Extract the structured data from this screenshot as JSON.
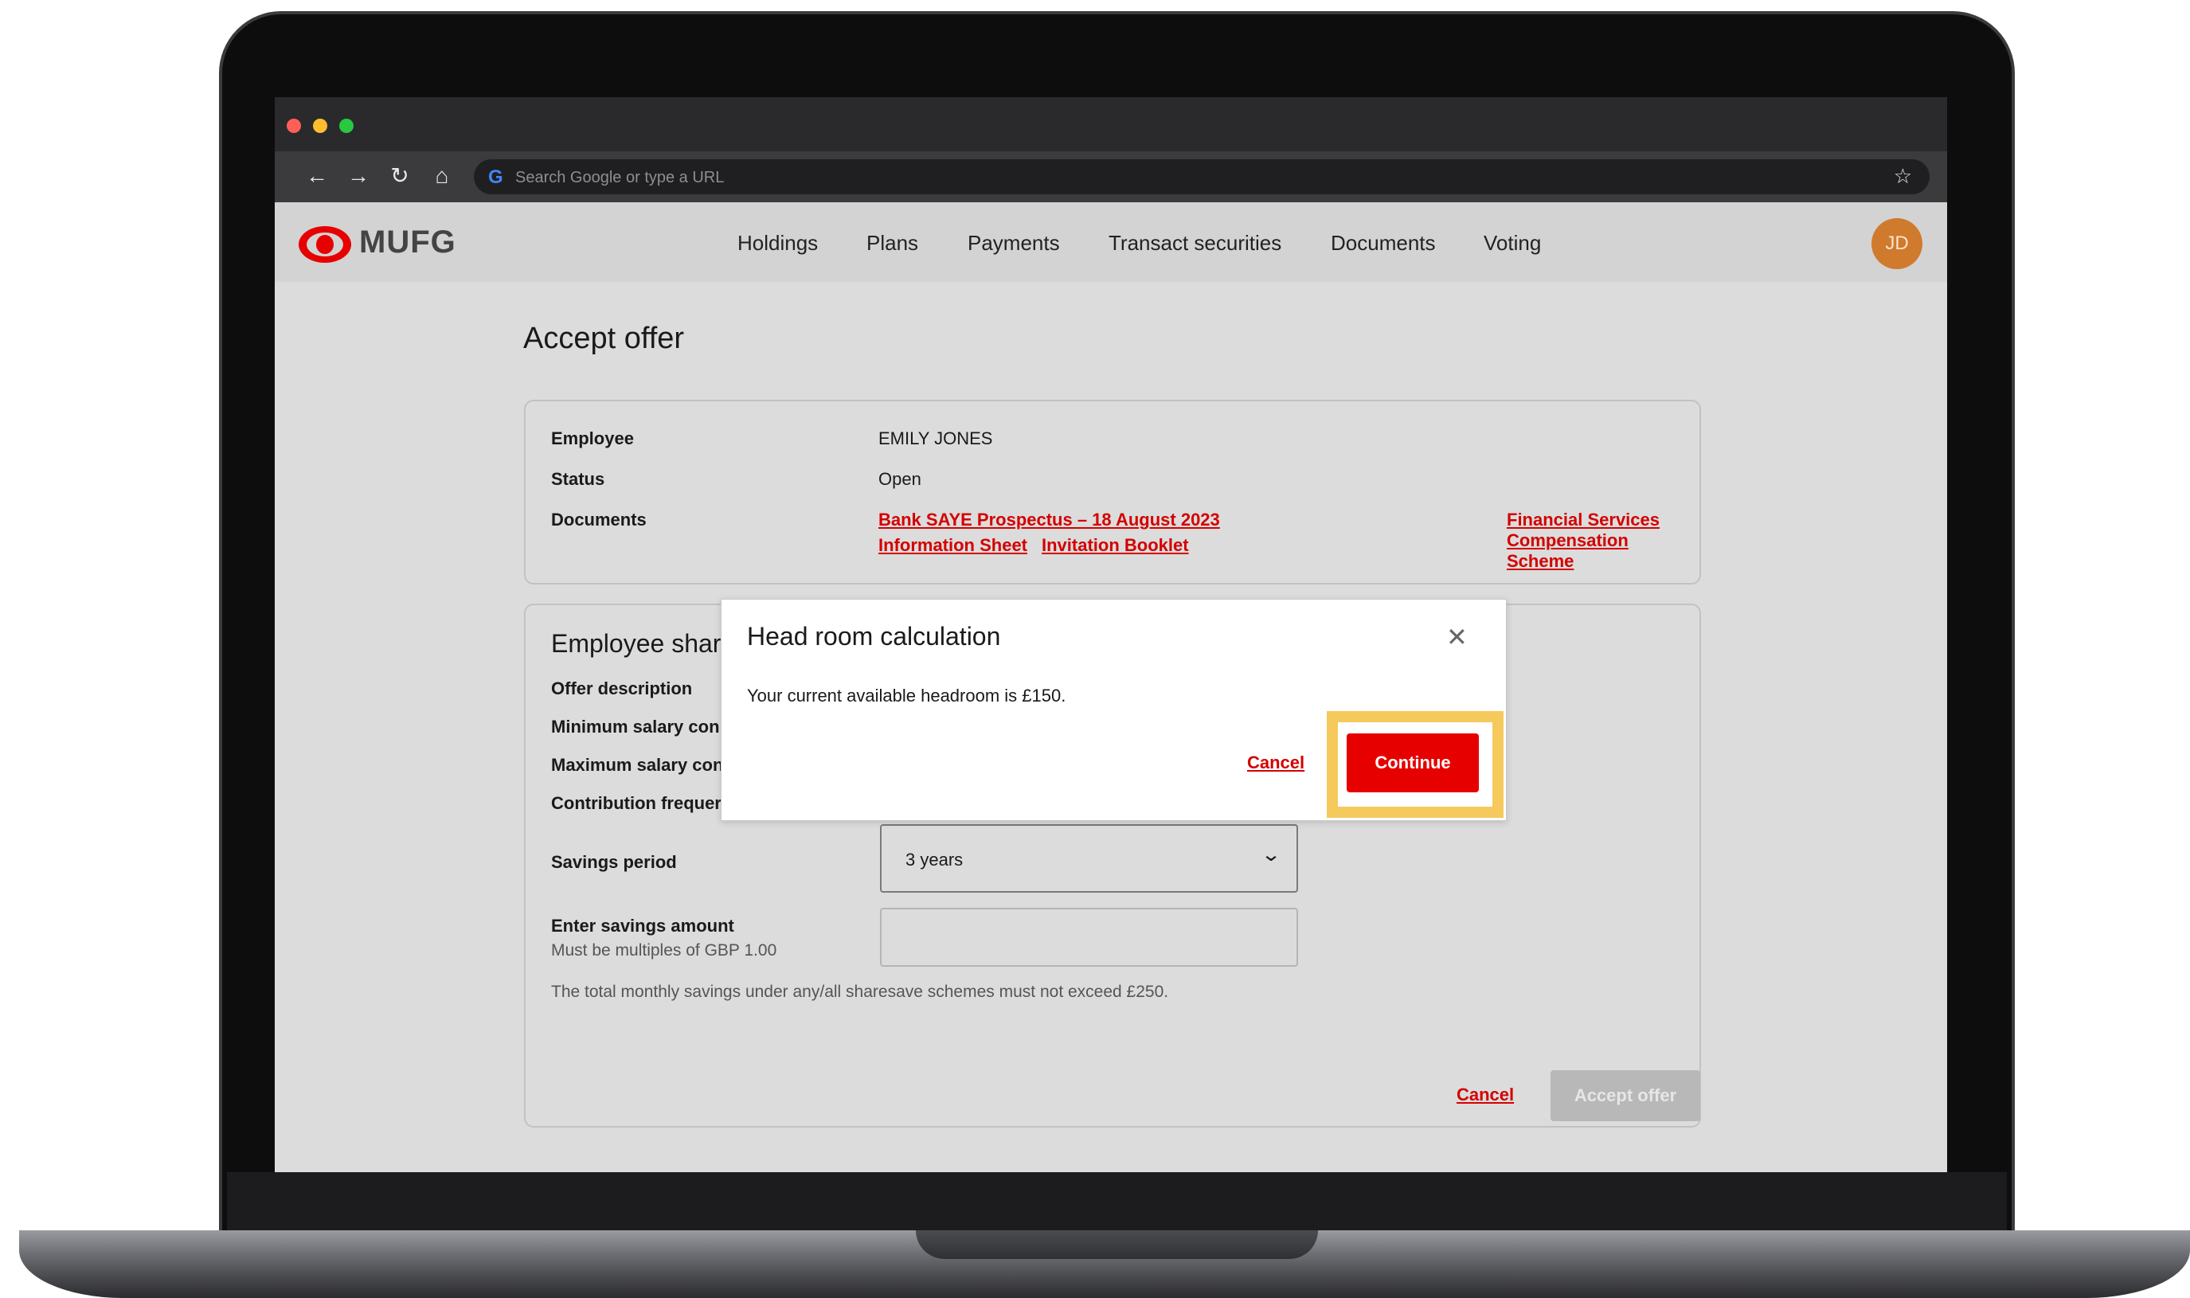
{
  "browser": {
    "search_placeholder": "Search Google or type a URL",
    "back_icon": "←",
    "forward_icon": "→",
    "reload_icon": "↻",
    "home_icon": "⌂",
    "google_icon": "G",
    "star_icon": "☆",
    "traffic_lights": [
      "#ff5f57",
      "#febc2e",
      "#28c840"
    ]
  },
  "header": {
    "logo_text": "MUFG",
    "nav": [
      "Holdings",
      "Plans",
      "Payments",
      "Transact securities",
      "Documents",
      "Voting"
    ],
    "avatar_initials": "JD",
    "brand_color": "#e60000"
  },
  "page": {
    "title": "Accept offer"
  },
  "summary": {
    "employee_label": "Employee",
    "employee_value": "EMILY JONES",
    "status_label": "Status",
    "status_value": "Open",
    "documents_label": "Documents",
    "documents": [
      "Bank SAYE Prospectus – 18 August 2023",
      "Financial Services Compensation Scheme",
      "Information Sheet",
      "Invitation Booklet"
    ]
  },
  "scheme": {
    "title_visible": "Employee shar",
    "rows_visible": [
      "Offer description",
      "Minimum salary con",
      "Maximum salary con",
      "Contribution frequer"
    ],
    "savings_period_label": "Savings period",
    "savings_period_value": "3 years",
    "savings_amount_label": "Enter savings amount",
    "savings_amount_hint": "Must be multiples of GBP 1.00",
    "savings_amount_value": "",
    "limit_note": "The total monthly savings under any/all sharesave schemes must not exceed £250."
  },
  "footer": {
    "cancel_label": "Cancel",
    "accept_label": "Accept offer"
  },
  "modal": {
    "title": "Head room calculation",
    "close_icon": "✕",
    "body": "Your current available headroom is £150.",
    "cancel_label": "Cancel",
    "continue_label": "Continue",
    "highlight_color": "#f6c95c"
  }
}
